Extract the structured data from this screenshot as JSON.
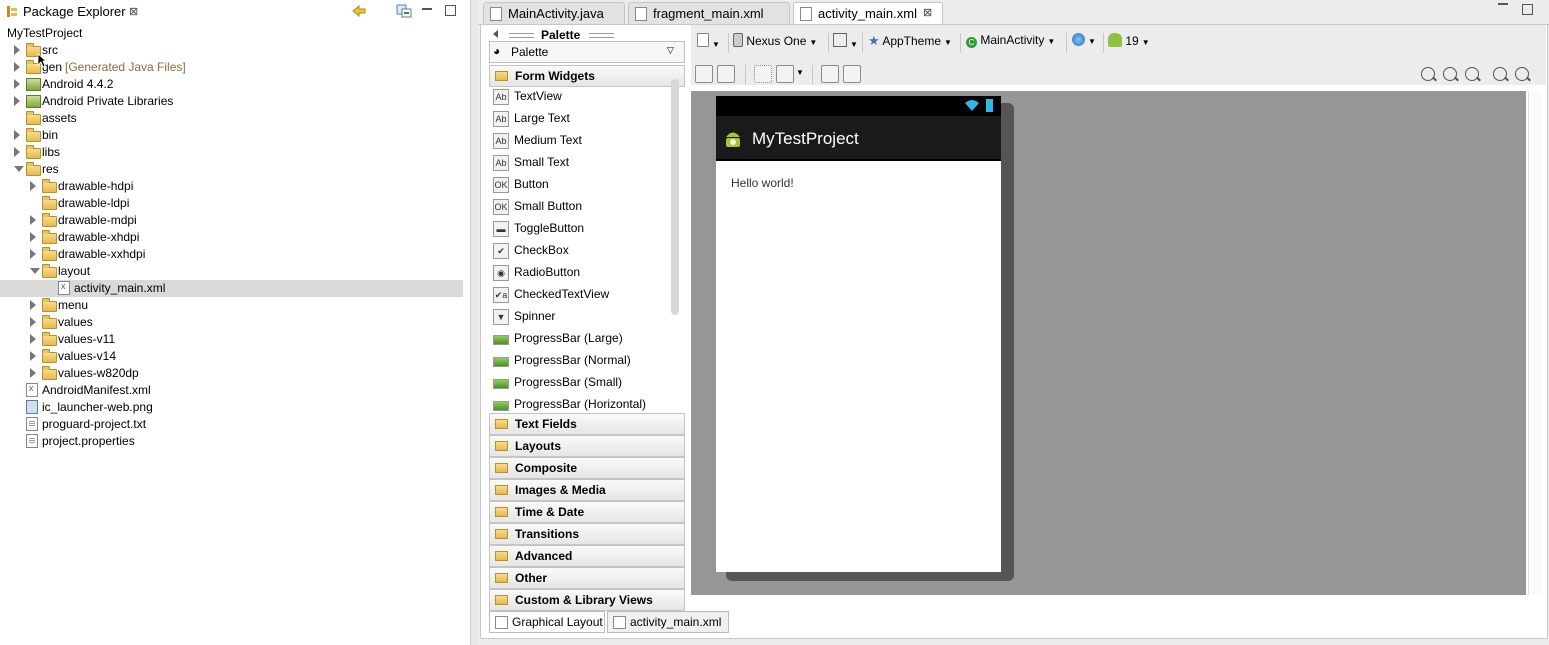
{
  "package_explorer": {
    "title": "Package Explorer",
    "close_glyph": "⊠",
    "project": "MyTestProject",
    "tree": [
      {
        "label": "src",
        "icon": "package-folder-icon",
        "depth": 0,
        "twisty": "closed"
      },
      {
        "label": "gen",
        "decoration": "[Generated Java Files]",
        "icon": "package-folder-icon",
        "depth": 0,
        "twisty": "closed"
      },
      {
        "label": "Android 4.4.2",
        "icon": "library-icon",
        "depth": 0,
        "twisty": "closed"
      },
      {
        "label": "Android Private Libraries",
        "icon": "library-icon",
        "depth": 0,
        "twisty": "closed"
      },
      {
        "label": "assets",
        "icon": "folder-icon",
        "depth": 0,
        "twisty": "none"
      },
      {
        "label": "bin",
        "icon": "folder-icon",
        "depth": 0,
        "twisty": "closed"
      },
      {
        "label": "libs",
        "icon": "folder-icon",
        "depth": 0,
        "twisty": "closed"
      },
      {
        "label": "res",
        "icon": "folder-icon",
        "depth": 0,
        "twisty": "open"
      },
      {
        "label": "drawable-hdpi",
        "icon": "folder-icon",
        "depth": 1,
        "twisty": "closed"
      },
      {
        "label": "drawable-ldpi",
        "icon": "folder-icon",
        "depth": 1,
        "twisty": "none"
      },
      {
        "label": "drawable-mdpi",
        "icon": "folder-icon",
        "depth": 1,
        "twisty": "closed"
      },
      {
        "label": "drawable-xhdpi",
        "icon": "folder-icon",
        "depth": 1,
        "twisty": "closed"
      },
      {
        "label": "drawable-xxhdpi",
        "icon": "folder-icon",
        "depth": 1,
        "twisty": "closed"
      },
      {
        "label": "layout",
        "icon": "folder-icon",
        "depth": 1,
        "twisty": "open"
      },
      {
        "label": "activity_main.xml",
        "icon": "xml-file-icon",
        "depth": 2,
        "twisty": "none",
        "selected": true
      },
      {
        "label": "menu",
        "icon": "folder-icon",
        "depth": 1,
        "twisty": "closed"
      },
      {
        "label": "values",
        "icon": "folder-icon",
        "depth": 1,
        "twisty": "closed"
      },
      {
        "label": "values-v11",
        "icon": "folder-icon",
        "depth": 1,
        "twisty": "closed"
      },
      {
        "label": "values-v14",
        "icon": "folder-icon",
        "depth": 1,
        "twisty": "closed"
      },
      {
        "label": "values-w820dp",
        "icon": "folder-icon",
        "depth": 1,
        "twisty": "closed"
      },
      {
        "label": "AndroidManifest.xml",
        "icon": "xml-file-icon",
        "depth": 0,
        "twisty": "none"
      },
      {
        "label": "ic_launcher-web.png",
        "icon": "image-file-icon",
        "depth": 0,
        "twisty": "none"
      },
      {
        "label": "proguard-project.txt",
        "icon": "text-file-icon",
        "depth": 0,
        "twisty": "none"
      },
      {
        "label": "project.properties",
        "icon": "text-file-icon",
        "depth": 0,
        "twisty": "none"
      }
    ]
  },
  "editor": {
    "tabs": [
      {
        "label": "MainActivity.java",
        "active": false
      },
      {
        "label": "fragment_main.xml",
        "active": false
      },
      {
        "label": "activity_main.xml",
        "active": true
      }
    ],
    "close_glyph": "⊠"
  },
  "palette": {
    "title": "Palette",
    "dropdown_label": "Palette",
    "open_category": "Form Widgets",
    "items": [
      {
        "label": "TextView",
        "glyph": "Ab"
      },
      {
        "label": "Large Text",
        "glyph": "Ab"
      },
      {
        "label": "Medium Text",
        "glyph": "Ab"
      },
      {
        "label": "Small Text",
        "glyph": "Ab"
      },
      {
        "label": "Button",
        "glyph": "OK"
      },
      {
        "label": "Small Button",
        "glyph": "OK"
      },
      {
        "label": "ToggleButton",
        "glyph": "▬"
      },
      {
        "label": "CheckBox",
        "glyph": "✔"
      },
      {
        "label": "RadioButton",
        "glyph": "◉"
      },
      {
        "label": "CheckedTextView",
        "glyph": "✔a"
      },
      {
        "label": "Spinner",
        "glyph": "▼"
      },
      {
        "label": "ProgressBar (Large)",
        "glyph": ""
      },
      {
        "label": "ProgressBar (Normal)",
        "glyph": ""
      },
      {
        "label": "ProgressBar (Small)",
        "glyph": ""
      },
      {
        "label": "ProgressBar (Horizontal)",
        "glyph": ""
      }
    ],
    "categories": [
      "Text Fields",
      "Layouts",
      "Composite",
      "Images & Media",
      "Time & Date",
      "Transitions",
      "Advanced",
      "Other",
      "Custom & Library Views"
    ]
  },
  "toolbar": {
    "device": "Nexus One",
    "theme": "AppTheme",
    "activity": "MainActivity",
    "api_level": "19"
  },
  "preview": {
    "app_title": "MyTestProject",
    "hello_text": "Hello world!"
  },
  "bottom_tabs": [
    {
      "label": "Graphical Layout",
      "active": true
    },
    {
      "label": "activity_main.xml",
      "active": false
    }
  ]
}
